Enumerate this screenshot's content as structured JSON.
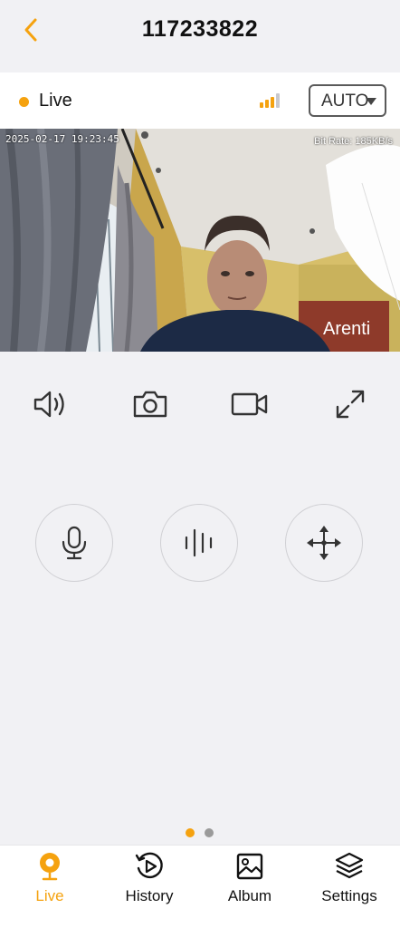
{
  "header": {
    "title": "117233822",
    "back_icon": "chevron-left-icon"
  },
  "status": {
    "live_label": "Live",
    "signal_icon": "signal-bars-icon",
    "quality_value": "AUTO"
  },
  "video": {
    "timestamp": "2025-02-17 19:23:45",
    "bitrate": "Bit Rate: 185KB/s",
    "watermark": "Arenti"
  },
  "controls": {
    "icons": [
      "speaker-icon",
      "camera-icon",
      "video-record-icon",
      "fullscreen-icon"
    ]
  },
  "actions": {
    "icons": [
      "microphone-icon",
      "voice-wave-icon",
      "pan-tilt-icon"
    ]
  },
  "pager": {
    "pages": 2,
    "current": 1
  },
  "tabs": [
    {
      "label": "Live",
      "icon": "live-pin-icon",
      "active": true
    },
    {
      "label": "History",
      "icon": "history-play-icon"
    },
    {
      "label": "Album",
      "icon": "album-image-icon"
    },
    {
      "label": "Settings",
      "icon": "layers-icon"
    }
  ],
  "colors": {
    "accent": "#f5a20f",
    "background": "#f1f1f4",
    "inactive_dot": "#9a9a9a"
  }
}
